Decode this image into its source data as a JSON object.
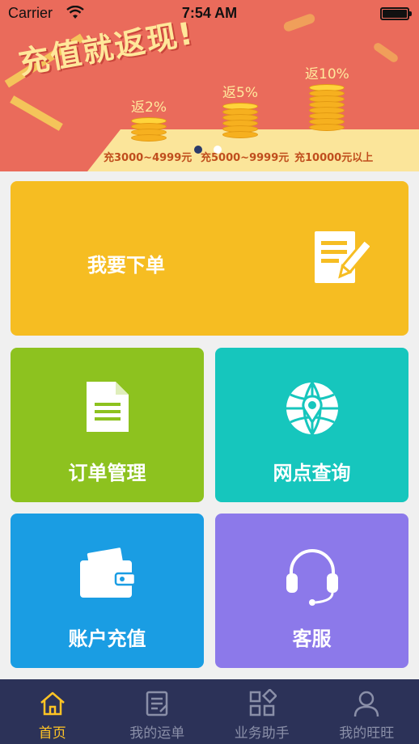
{
  "status_bar": {
    "carrier": "Carrier",
    "time": "7:54 AM"
  },
  "banner": {
    "title": "充值就返现!",
    "tiers": [
      {
        "rebate": "返2%",
        "range": "充3000~4999元"
      },
      {
        "rebate": "返5%",
        "range": "充5000~9999元"
      },
      {
        "rebate": "返10%",
        "range": "充10000元以上"
      }
    ],
    "page_indicator": {
      "count": 2,
      "active": 1
    }
  },
  "tiles": {
    "order": "我要下单",
    "order_manage": "订单管理",
    "branch_query": "网点查询",
    "recharge": "账户充值",
    "service": "客服"
  },
  "colors": {
    "banner": "#ea6b5b",
    "order": "#f6bd22",
    "order_manage": "#8dc21f",
    "branch_query": "#16c6bd",
    "recharge": "#1a9de3",
    "service": "#8c79ea",
    "tabbar": "#2c3258",
    "tab_active": "#ffc425"
  },
  "tabbar": {
    "items": [
      {
        "label": "首页",
        "icon": "home-icon",
        "active": true
      },
      {
        "label": "我的运单",
        "icon": "waybill-icon",
        "active": false
      },
      {
        "label": "业务助手",
        "icon": "apps-icon",
        "active": false
      },
      {
        "label": "我的旺旺",
        "icon": "user-icon",
        "active": false
      }
    ]
  }
}
